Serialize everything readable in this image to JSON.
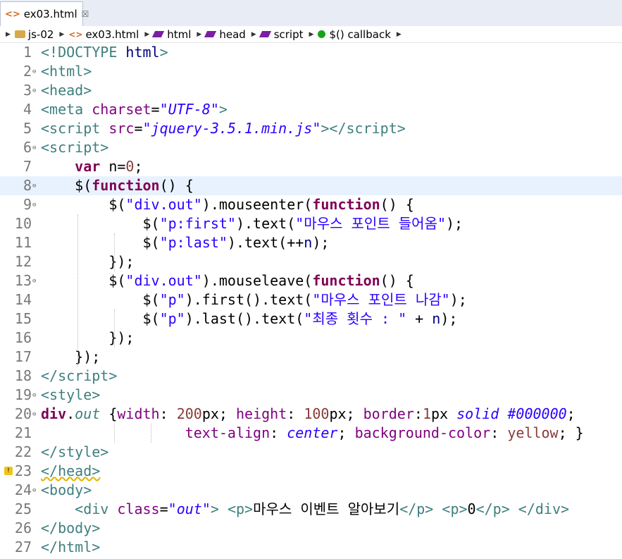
{
  "tab": {
    "title": "ex03.html",
    "close": "☒"
  },
  "breadcrumb": [
    {
      "label": "js-02",
      "icon": "folder-icon"
    },
    {
      "label": "ex03.html",
      "icon": "html-file-icon"
    },
    {
      "label": "html",
      "icon": "tag-icon"
    },
    {
      "label": "head",
      "icon": "tag-icon"
    },
    {
      "label": "script",
      "icon": "tag-icon"
    },
    {
      "label": "$() callback",
      "icon": "function-icon"
    }
  ],
  "lines": [
    {
      "n": "1",
      "html": "<span class='t'>&lt;!DOCTYPE </span><span class='ident'>html</span><span class='t'>&gt;</span>"
    },
    {
      "n": "2",
      "fold": true,
      "html": "<span class='t'>&lt;html&gt;</span>"
    },
    {
      "n": "3",
      "fold": true,
      "html": "<span class='t'>&lt;head&gt;</span>"
    },
    {
      "n": "4",
      "html": "<span class='t'>&lt;meta </span><span class='a'>charset</span>=<span class='s'>\"UTF-8\"</span><span class='t'>&gt;</span>"
    },
    {
      "n": "5",
      "html": "<span class='t'>&lt;script </span><span class='a'>src</span>=<span class='s'>\"jquery-3.5.1.min.js\"</span><span class='t'>&gt;&lt;/script&gt;</span>"
    },
    {
      "n": "6",
      "fold": true,
      "html": "<span class='t'>&lt;script&gt;</span>"
    },
    {
      "n": "7",
      "html": "    <span class='k'>var</span> n=<span class='num'>0</span>;"
    },
    {
      "n": "8",
      "fold": true,
      "cur": true,
      "html": "    $(<span class='k'>function</span>() {"
    },
    {
      "n": "9",
      "fold": true,
      "html": "        $(<span class='str'>\"div.out\"</span>).mouseenter(<span class='k'>function</span>() {"
    },
    {
      "n": "10",
      "html": "            $(<span class='str'>\"p:first\"</span>).text(<span class='str'>\"마우스 포인트 들어옴\"</span>);"
    },
    {
      "n": "11",
      "html": "            $(<span class='str'>\"p:last\"</span>).text(++<span class='ident'>n</span>);"
    },
    {
      "n": "12",
      "html": "        });"
    },
    {
      "n": "13",
      "fold": true,
      "html": "        $(<span class='str'>\"div.out\"</span>).mouseleave(<span class='k'>function</span>() {"
    },
    {
      "n": "14",
      "html": "            $(<span class='str'>\"p\"</span>).first().text(<span class='str'>\"마우스 포인트 나감\"</span>);"
    },
    {
      "n": "15",
      "html": "            $(<span class='str'>\"p\"</span>).last().text(<span class='str'>\"최종 횟수 : \"</span> + <span class='ident'>n</span>);"
    },
    {
      "n": "16",
      "html": "        });"
    },
    {
      "n": "17",
      "html": "    });"
    },
    {
      "n": "18",
      "html": "<span class='t'>&lt;/script&gt;</span>"
    },
    {
      "n": "19",
      "fold": true,
      "html": "<span class='t'>&lt;style&gt;</span>"
    },
    {
      "n": "20",
      "fold": true,
      "html": "<span class='sel'>div</span>.<span class='cls'>out</span> {<span class='prop'>width</span>: <span class='num'>200</span>px; <span class='prop'>height</span>: <span class='num'>100</span>px; <span class='prop'>border</span>:<span class='num'>1</span>px <span class='val'>solid</span> <span class='val'>#000000</span>;"
    },
    {
      "n": "21",
      "html": "                 <span class='prop'>text-align</span>: <span class='val'>center</span>; <span class='prop'>background-color</span>: <span class='num'>yellow</span>; }"
    },
    {
      "n": "22",
      "html": "<span class='t'>&lt;/style&gt;</span>"
    },
    {
      "n": "23",
      "warn": true,
      "html": "<span class='t wavy'>&lt;/head&gt;</span>"
    },
    {
      "n": "24",
      "fold": true,
      "html": "<span class='t'>&lt;body&gt;</span>"
    },
    {
      "n": "25",
      "html": "    <span class='t'>&lt;div </span><span class='a'>class</span>=<span class='s'>\"out\"</span><span class='t'>&gt;</span> <span class='t'>&lt;p&gt;</span>마우스 이벤트 알아보기<span class='t'>&lt;/p&gt;</span> <span class='t'>&lt;p&gt;</span>0<span class='t'>&lt;/p&gt;</span> <span class='t'>&lt;/div&gt;</span>"
    },
    {
      "n": "26",
      "html": "<span class='t'>&lt;/body&gt;</span>"
    },
    {
      "n": "27",
      "html": "<span class='t'>&lt;/html&gt;</span>"
    }
  ]
}
